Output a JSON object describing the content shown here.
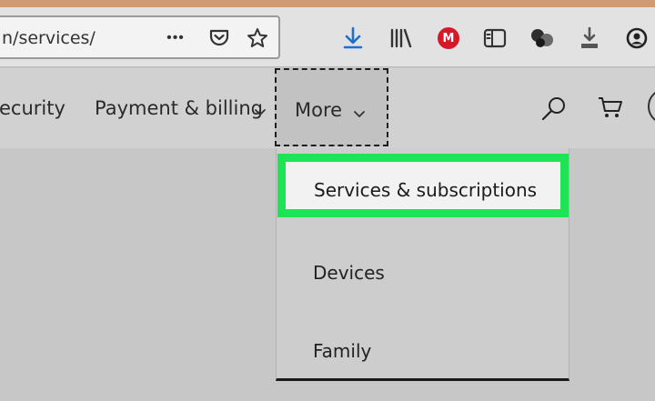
{
  "browser": {
    "url_text": "n/services/",
    "buttons": {
      "more_actions": "•••",
      "pocket": "pocket-icon",
      "bookmark_star": "star-icon",
      "downloads": "download-icon",
      "library": "library-icon",
      "mega_extension": "M",
      "sidebar": "sidebar-icon",
      "extension_circles": "extension-icon",
      "save_page": "save-icon",
      "account": "account-icon"
    }
  },
  "nav": {
    "items": [
      {
        "label": "ecurity"
      },
      {
        "label": "Payment & billing"
      },
      {
        "label": "More"
      }
    ],
    "search_icon": "search-icon",
    "cart_icon": "cart-icon"
  },
  "dropdown": {
    "items": [
      {
        "label": "Services & subscriptions",
        "highlighted": true
      },
      {
        "label": "Devices"
      },
      {
        "label": "Family"
      }
    ]
  },
  "colors": {
    "highlight_border": "#1ee455",
    "download_icon": "#1f6fd0",
    "mega_red": "#d7182a"
  }
}
